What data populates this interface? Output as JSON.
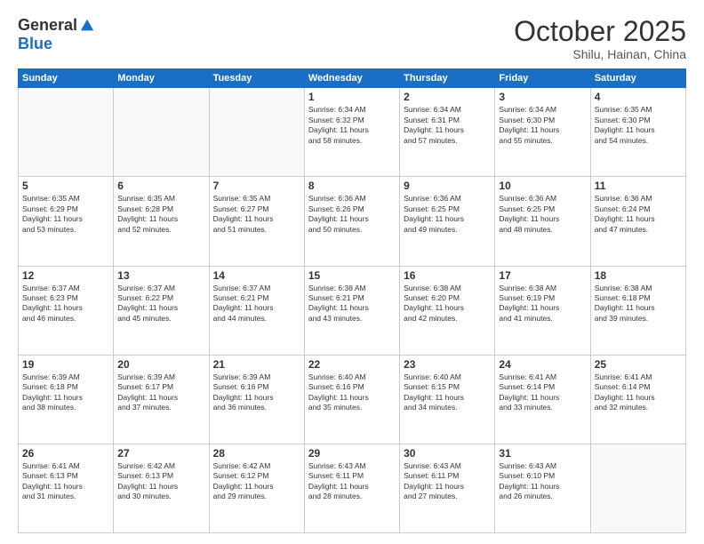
{
  "logo": {
    "general": "General",
    "blue": "Blue"
  },
  "header": {
    "month": "October 2025",
    "location": "Shilu, Hainan, China"
  },
  "weekdays": [
    "Sunday",
    "Monday",
    "Tuesday",
    "Wednesday",
    "Thursday",
    "Friday",
    "Saturday"
  ],
  "weeks": [
    [
      {
        "day": "",
        "info": ""
      },
      {
        "day": "",
        "info": ""
      },
      {
        "day": "",
        "info": ""
      },
      {
        "day": "1",
        "info": "Sunrise: 6:34 AM\nSunset: 6:32 PM\nDaylight: 11 hours\nand 58 minutes."
      },
      {
        "day": "2",
        "info": "Sunrise: 6:34 AM\nSunset: 6:31 PM\nDaylight: 11 hours\nand 57 minutes."
      },
      {
        "day": "3",
        "info": "Sunrise: 6:34 AM\nSunset: 6:30 PM\nDaylight: 11 hours\nand 55 minutes."
      },
      {
        "day": "4",
        "info": "Sunrise: 6:35 AM\nSunset: 6:30 PM\nDaylight: 11 hours\nand 54 minutes."
      }
    ],
    [
      {
        "day": "5",
        "info": "Sunrise: 6:35 AM\nSunset: 6:29 PM\nDaylight: 11 hours\nand 53 minutes."
      },
      {
        "day": "6",
        "info": "Sunrise: 6:35 AM\nSunset: 6:28 PM\nDaylight: 11 hours\nand 52 minutes."
      },
      {
        "day": "7",
        "info": "Sunrise: 6:35 AM\nSunset: 6:27 PM\nDaylight: 11 hours\nand 51 minutes."
      },
      {
        "day": "8",
        "info": "Sunrise: 6:36 AM\nSunset: 6:26 PM\nDaylight: 11 hours\nand 50 minutes."
      },
      {
        "day": "9",
        "info": "Sunrise: 6:36 AM\nSunset: 6:25 PM\nDaylight: 11 hours\nand 49 minutes."
      },
      {
        "day": "10",
        "info": "Sunrise: 6:36 AM\nSunset: 6:25 PM\nDaylight: 11 hours\nand 48 minutes."
      },
      {
        "day": "11",
        "info": "Sunrise: 6:36 AM\nSunset: 6:24 PM\nDaylight: 11 hours\nand 47 minutes."
      }
    ],
    [
      {
        "day": "12",
        "info": "Sunrise: 6:37 AM\nSunset: 6:23 PM\nDaylight: 11 hours\nand 46 minutes."
      },
      {
        "day": "13",
        "info": "Sunrise: 6:37 AM\nSunset: 6:22 PM\nDaylight: 11 hours\nand 45 minutes."
      },
      {
        "day": "14",
        "info": "Sunrise: 6:37 AM\nSunset: 6:21 PM\nDaylight: 11 hours\nand 44 minutes."
      },
      {
        "day": "15",
        "info": "Sunrise: 6:38 AM\nSunset: 6:21 PM\nDaylight: 11 hours\nand 43 minutes."
      },
      {
        "day": "16",
        "info": "Sunrise: 6:38 AM\nSunset: 6:20 PM\nDaylight: 11 hours\nand 42 minutes."
      },
      {
        "day": "17",
        "info": "Sunrise: 6:38 AM\nSunset: 6:19 PM\nDaylight: 11 hours\nand 41 minutes."
      },
      {
        "day": "18",
        "info": "Sunrise: 6:38 AM\nSunset: 6:18 PM\nDaylight: 11 hours\nand 39 minutes."
      }
    ],
    [
      {
        "day": "19",
        "info": "Sunrise: 6:39 AM\nSunset: 6:18 PM\nDaylight: 11 hours\nand 38 minutes."
      },
      {
        "day": "20",
        "info": "Sunrise: 6:39 AM\nSunset: 6:17 PM\nDaylight: 11 hours\nand 37 minutes."
      },
      {
        "day": "21",
        "info": "Sunrise: 6:39 AM\nSunset: 6:16 PM\nDaylight: 11 hours\nand 36 minutes."
      },
      {
        "day": "22",
        "info": "Sunrise: 6:40 AM\nSunset: 6:16 PM\nDaylight: 11 hours\nand 35 minutes."
      },
      {
        "day": "23",
        "info": "Sunrise: 6:40 AM\nSunset: 6:15 PM\nDaylight: 11 hours\nand 34 minutes."
      },
      {
        "day": "24",
        "info": "Sunrise: 6:41 AM\nSunset: 6:14 PM\nDaylight: 11 hours\nand 33 minutes."
      },
      {
        "day": "25",
        "info": "Sunrise: 6:41 AM\nSunset: 6:14 PM\nDaylight: 11 hours\nand 32 minutes."
      }
    ],
    [
      {
        "day": "26",
        "info": "Sunrise: 6:41 AM\nSunset: 6:13 PM\nDaylight: 11 hours\nand 31 minutes."
      },
      {
        "day": "27",
        "info": "Sunrise: 6:42 AM\nSunset: 6:13 PM\nDaylight: 11 hours\nand 30 minutes."
      },
      {
        "day": "28",
        "info": "Sunrise: 6:42 AM\nSunset: 6:12 PM\nDaylight: 11 hours\nand 29 minutes."
      },
      {
        "day": "29",
        "info": "Sunrise: 6:43 AM\nSunset: 6:11 PM\nDaylight: 11 hours\nand 28 minutes."
      },
      {
        "day": "30",
        "info": "Sunrise: 6:43 AM\nSunset: 6:11 PM\nDaylight: 11 hours\nand 27 minutes."
      },
      {
        "day": "31",
        "info": "Sunrise: 6:43 AM\nSunset: 6:10 PM\nDaylight: 11 hours\nand 26 minutes."
      },
      {
        "day": "",
        "info": ""
      }
    ]
  ]
}
